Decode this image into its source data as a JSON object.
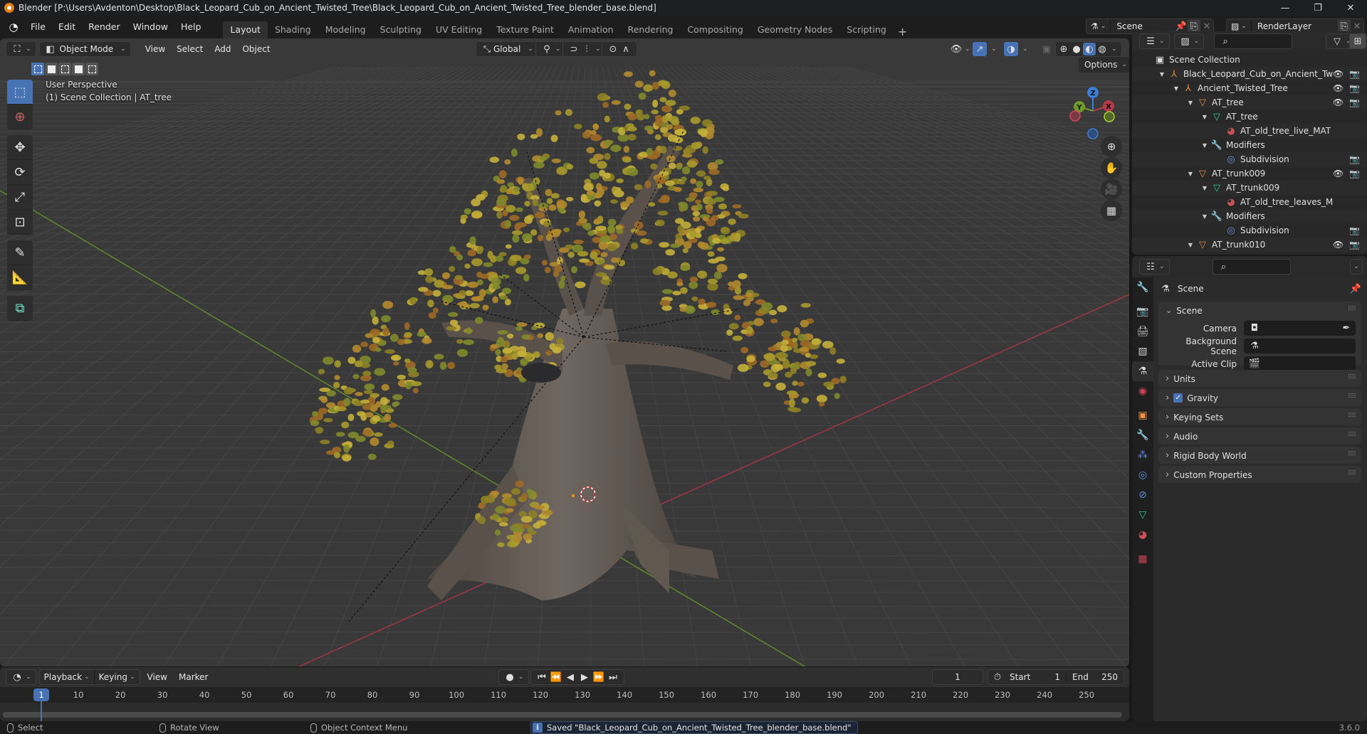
{
  "window": {
    "title": "Blender [P:\\Users\\Avdenton\\Desktop\\Black_Leopard_Cub_on_Ancient_Twisted_Tree\\Black_Leopard_Cub_on_Ancient_Twisted_Tree_blender_base.blend]",
    "minimize": "—",
    "maximize": "❐",
    "close": "✕"
  },
  "menubar": {
    "items": [
      "File",
      "Edit",
      "Render",
      "Window",
      "Help"
    ]
  },
  "workspaces": {
    "tabs": [
      "Layout",
      "Shading",
      "Modeling",
      "Sculpting",
      "UV Editing",
      "Texture Paint",
      "Animation",
      "Rendering",
      "Compositing",
      "Geometry Nodes",
      "Scripting"
    ],
    "active": "Layout",
    "add": "+"
  },
  "scene_selector": {
    "value": "Scene"
  },
  "view_layer_selector": {
    "value": "RenderLayer"
  },
  "viewport": {
    "mode": "Object Mode",
    "menus": [
      "View",
      "Select",
      "Add",
      "Object"
    ],
    "transform_orientation": "Global",
    "options_label": "Options",
    "info_line1": "User Perspective",
    "info_line2": "(1) Scene Collection | AT_tree",
    "gizmo_axes": {
      "x": "X",
      "y": "Y",
      "z": "Z"
    },
    "colors": {
      "x_axis": "#b4394a",
      "y_axis": "#6f9a2a",
      "z_axis": "#3b7fd8",
      "accent": "#4772b3",
      "grid": "#454545",
      "background": "#393939"
    }
  },
  "outliner": {
    "rows": [
      {
        "label": "Scene Collection",
        "depth": 0,
        "icon": "collection-box-icon",
        "expand": "",
        "eye": false,
        "cam": false
      },
      {
        "label": "Black_Leopard_Cub_on_Ancient_Twister",
        "depth": 1,
        "icon": "empty-icon",
        "expand": "▼",
        "eye": true,
        "cam": true
      },
      {
        "label": "Ancient_Twisted_Tree",
        "depth": 2,
        "icon": "empty-icon",
        "expand": "▼",
        "eye": true,
        "cam": true
      },
      {
        "label": "AT_tree",
        "depth": 3,
        "icon": "mesh-object-icon",
        "expand": "▼",
        "eye": true,
        "cam": true
      },
      {
        "label": "AT_tree",
        "depth": 4,
        "icon": "mesh-data-icon",
        "expand": "▼",
        "eye": false,
        "cam": false
      },
      {
        "label": "AT_old_tree_live_MAT",
        "depth": 5,
        "icon": "material-icon",
        "expand": "",
        "eye": false,
        "cam": false
      },
      {
        "label": "Modifiers",
        "depth": 4,
        "icon": "wrench-icon",
        "expand": "▼",
        "eye": false,
        "cam": false
      },
      {
        "label": "Subdivision",
        "depth": 5,
        "icon": "subdivision-icon",
        "expand": "",
        "eye": false,
        "cam": true
      },
      {
        "label": "AT_trunk009",
        "depth": 3,
        "icon": "mesh-object-icon",
        "expand": "▼",
        "eye": true,
        "cam": true
      },
      {
        "label": "AT_trunk009",
        "depth": 4,
        "icon": "mesh-data-icon",
        "expand": "▼",
        "eye": false,
        "cam": false
      },
      {
        "label": "AT_old_tree_leaves_MA",
        "depth": 5,
        "icon": "material-icon",
        "expand": "",
        "eye": false,
        "cam": false
      },
      {
        "label": "Modifiers",
        "depth": 4,
        "icon": "wrench-icon",
        "expand": "▼",
        "eye": false,
        "cam": false
      },
      {
        "label": "Subdivision",
        "depth": 5,
        "icon": "subdivision-icon",
        "expand": "",
        "eye": false,
        "cam": true
      },
      {
        "label": "AT_trunk010",
        "depth": 3,
        "icon": "mesh-object-icon",
        "expand": "▼",
        "eye": true,
        "cam": true
      }
    ]
  },
  "properties": {
    "context_title": "Scene",
    "scene_panel": {
      "title": "Scene",
      "fields": [
        {
          "label": "Camera",
          "value": ""
        },
        {
          "label": "Background Scene",
          "value": ""
        },
        {
          "label": "Active Clip",
          "value": ""
        }
      ]
    },
    "collapsed_panels": [
      {
        "label": "Units",
        "checkbox": false
      },
      {
        "label": "Gravity",
        "checkbox": true,
        "checked": true
      },
      {
        "label": "Keying Sets",
        "checkbox": false
      },
      {
        "label": "Audio",
        "checkbox": false
      },
      {
        "label": "Rigid Body World",
        "checkbox": false
      },
      {
        "label": "Custom Properties",
        "checkbox": false
      }
    ]
  },
  "timeline": {
    "menus": [
      "Playback",
      "Keying",
      "View",
      "Marker"
    ],
    "current_frame": "1",
    "start_label": "Start",
    "start": "1",
    "end_label": "End",
    "end": "250",
    "ticks": [
      "10",
      "20",
      "30",
      "40",
      "50",
      "60",
      "70",
      "80",
      "90",
      "100",
      "110",
      "120",
      "130",
      "140",
      "150",
      "160",
      "170",
      "180",
      "190",
      "200",
      "210",
      "220",
      "230",
      "240",
      "250"
    ]
  },
  "statusbar": {
    "select": "Select",
    "rotate": "Rotate View",
    "context_menu": "Object Context Menu",
    "message": "Saved \"Black_Leopard_Cub_on_Ancient_Twisted_Tree_blender_base.blend\"",
    "version": "3.6.0"
  }
}
